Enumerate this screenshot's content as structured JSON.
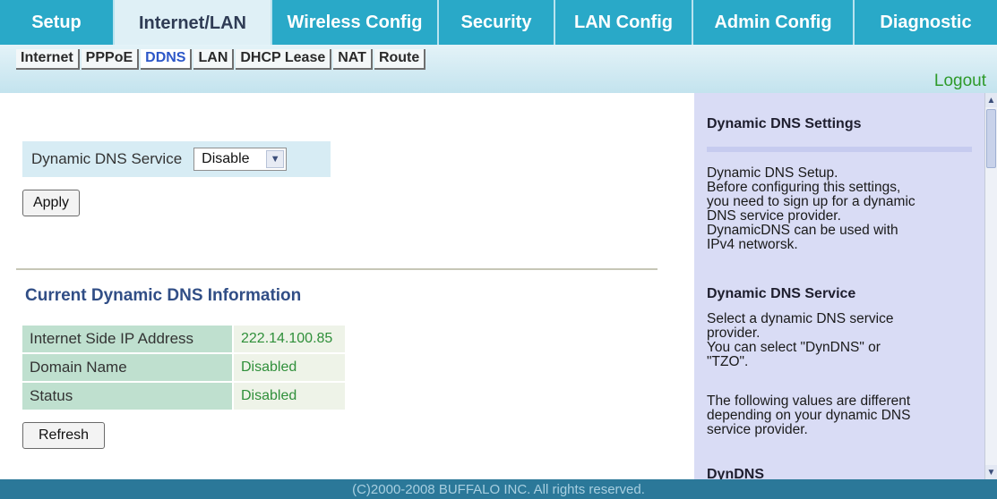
{
  "topnav": {
    "tabs": [
      {
        "label": "Setup"
      },
      {
        "label": "Internet/LAN"
      },
      {
        "label": "Wireless Config"
      },
      {
        "label": "Security"
      },
      {
        "label": "LAN Config"
      },
      {
        "label": "Admin Config"
      },
      {
        "label": "Diagnostic"
      }
    ],
    "active": "Internet/LAN"
  },
  "subnav": {
    "items": [
      {
        "label": "Internet"
      },
      {
        "label": "PPPoE"
      },
      {
        "label": "DDNS"
      },
      {
        "label": "LAN"
      },
      {
        "label": "DHCP Lease"
      },
      {
        "label": "NAT"
      },
      {
        "label": "Route"
      }
    ],
    "active": "DDNS",
    "logout_label": "Logout"
  },
  "form": {
    "dns_service_label": "Dynamic DNS Service",
    "dns_service_value": "Disable",
    "apply_label": "Apply"
  },
  "info": {
    "heading": "Current Dynamic DNS Information",
    "rows": [
      {
        "label": "Internet Side IP Address",
        "value": "222.14.100.85"
      },
      {
        "label": "Domain Name",
        "value": "Disabled"
      },
      {
        "label": "Status",
        "value": "Disabled"
      }
    ],
    "refresh_label": "Refresh"
  },
  "help": {
    "title": "Dynamic DNS Settings",
    "setup_text": "Dynamic DNS Setup.\nBefore configuring this settings,\nyou need to sign up for a dynamic\nDNS service provider.\nDynamicDNS can be used with\nIPv4 networsk.",
    "service_heading": "Dynamic DNS Service",
    "service_text": "Select a dynamic DNS service\nprovider.\nYou can select \"DynDNS\" or\n\"TZO\".",
    "values_text": "The following values are different\ndepending on your dynamic DNS\nservice provider.",
    "next_heading": "DynDNS"
  },
  "footer": {
    "copyright": "(C)2000-2008 BUFFALO INC. All rights reserved."
  }
}
